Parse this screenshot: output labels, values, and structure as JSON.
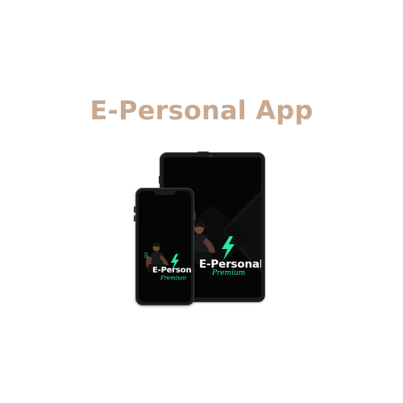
{
  "page": {
    "title": "E-Personal App",
    "title_color": "#c9a88e"
  },
  "app": {
    "brand_name": "E-Personal",
    "brand_tagline": "Premium",
    "accent_color": "#2ee6a6",
    "screen_background": "#050505"
  },
  "devices": {
    "tablet": {
      "label": "tablet-mockup"
    },
    "phone": {
      "label": "phone-mockup"
    }
  }
}
